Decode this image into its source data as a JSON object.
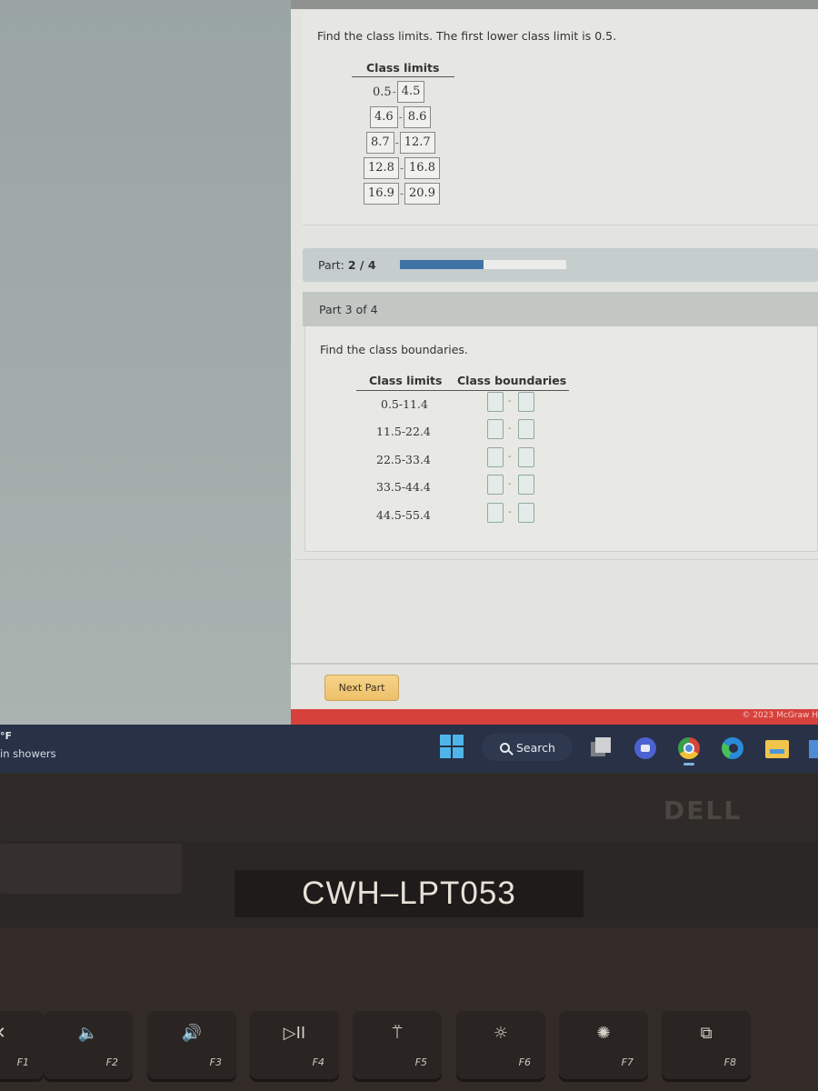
{
  "weather": {
    "temp": "°F",
    "description": "in showers"
  },
  "part1": {
    "instruction": "Find the class limits. The first lower class limit is 0.5.",
    "header": "Class limits",
    "rows": [
      {
        "lower": "0.5",
        "upper": "4.5",
        "lower_boxed": false
      },
      {
        "lower": "4.6",
        "upper": "8.6",
        "lower_boxed": true
      },
      {
        "lower": "8.7",
        "upper": "12.7",
        "lower_boxed": true
      },
      {
        "lower": "12.8",
        "upper": "16.8",
        "lower_boxed": true
      },
      {
        "lower": "16.9",
        "upper": "20.9",
        "lower_boxed": true
      }
    ]
  },
  "progress": {
    "label": "Part:",
    "current": "2 / 4",
    "fraction": 0.5
  },
  "part3": {
    "title": "Part 3 of 4",
    "instruction": "Find the class boundaries.",
    "header_limits": "Class limits",
    "header_boundaries": "Class boundaries",
    "rows": [
      {
        "limits": "0.5-11.4",
        "lower_boundary": "",
        "upper_boundary": ""
      },
      {
        "limits": "11.5-22.4",
        "lower_boundary": "",
        "upper_boundary": ""
      },
      {
        "limits": "22.5-33.4",
        "lower_boundary": "",
        "upper_boundary": ""
      },
      {
        "limits": "33.5-44.4",
        "lower_boundary": "",
        "upper_boundary": ""
      },
      {
        "limits": "44.5-55.4",
        "lower_boundary": "",
        "upper_boundary": ""
      }
    ],
    "dash": "-"
  },
  "next_part_label": "Next Part",
  "footer": {
    "copyright": "© 2023 McGraw H"
  },
  "taskbar": {
    "search_label": "Search",
    "apps": [
      "task-view",
      "meet",
      "chrome",
      "edge",
      "file-explorer",
      "store"
    ],
    "colors": {
      "start": "#4fb5e8",
      "background": "#283146"
    }
  },
  "laptop": {
    "brand": "DELL",
    "asset_tag": "CWH–LPT053",
    "fkeys": [
      {
        "label": "F1",
        "icon": "mute-icon",
        "glyph": "✕"
      },
      {
        "label": "F2",
        "icon": "volume-down-icon",
        "glyph": "🔈"
      },
      {
        "label": "F3",
        "icon": "volume-up-icon",
        "glyph": "🔊"
      },
      {
        "label": "F4",
        "icon": "play-pause-icon",
        "glyph": "▷II"
      },
      {
        "label": "F5",
        "icon": "keyboard-backlight-icon",
        "glyph": "⍡"
      },
      {
        "label": "F6",
        "icon": "brightness-down-icon",
        "glyph": "☼"
      },
      {
        "label": "F7",
        "icon": "brightness-up-icon",
        "glyph": "✺"
      },
      {
        "label": "F8",
        "icon": "display-switch-icon",
        "glyph": "⧉"
      }
    ]
  },
  "colors": {
    "accent_progress": "#3f73a5",
    "next_button": "#f0c36e",
    "footer_red": "#d7413c"
  }
}
